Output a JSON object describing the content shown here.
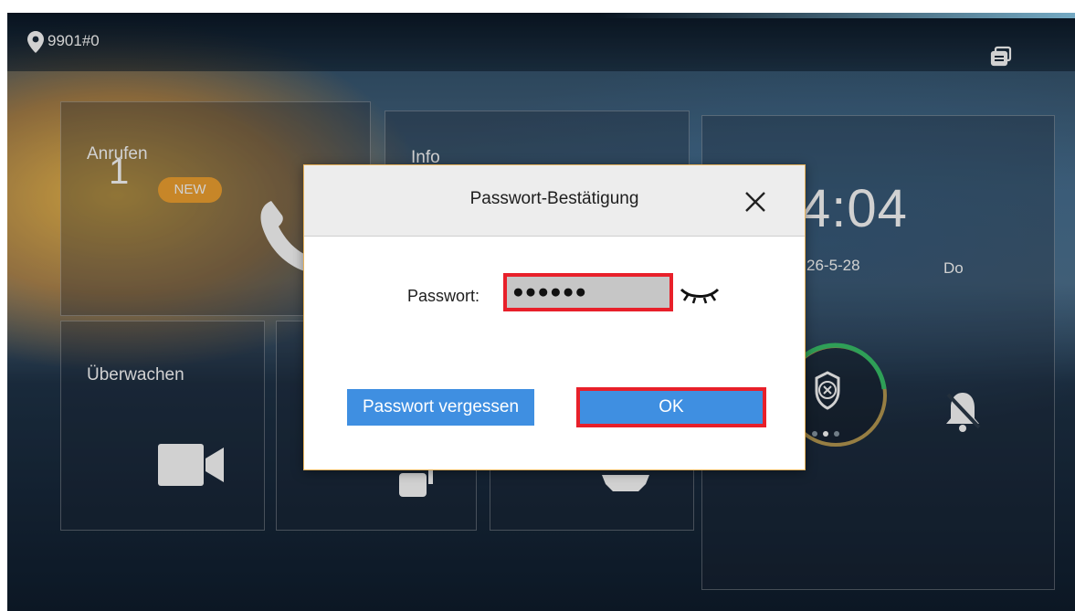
{
  "status_bar": {
    "location_icon": "map-pin-icon",
    "location_text": "9901#0",
    "multi_window_icon": "multi-window-icon"
  },
  "tiles": {
    "call": {
      "title": "Anrufen",
      "count": "1",
      "badge": "NEW",
      "icon": "phone-icon"
    },
    "info": {
      "title": "Info"
    },
    "monitor": {
      "title": "Überwachen",
      "icon": "video-camera-icon"
    },
    "clock": {
      "time": "4:04",
      "date": "26-5-28",
      "day": "Do"
    },
    "arm": {
      "icon": "shield-x-icon"
    },
    "bell": {
      "icon": "bell-off-icon"
    }
  },
  "dialog": {
    "title": "Passwort-Bestätigung",
    "close_icon": "close-icon",
    "password_label": "Passwort:",
    "password_value": "●●●●●●",
    "eye_icon": "eye-closed-icon",
    "forgot_label": "Passwort vergessen",
    "ok_label": "OK"
  },
  "colors": {
    "button_blue": "#3f8fe1",
    "highlight_red": "#e8202a",
    "badge_orange": "#f3a431",
    "ring_green": "#39c26b"
  }
}
